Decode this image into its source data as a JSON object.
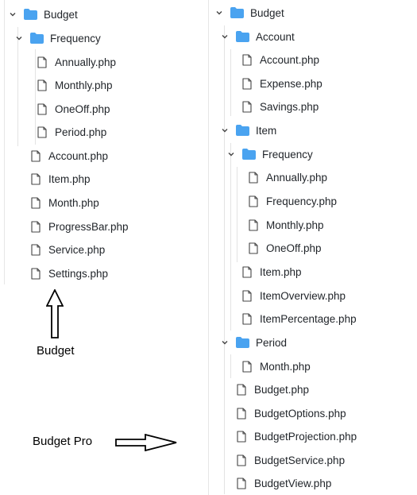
{
  "left_tree": {
    "root": "Budget",
    "frequency_folder": "Frequency",
    "frequency_files": [
      "Annually.php",
      "Monthly.php",
      "OneOff.php",
      "Period.php"
    ],
    "root_files": [
      "Account.php",
      "Item.php",
      "Month.php",
      "ProgressBar.php",
      "Service.php",
      "Settings.php"
    ]
  },
  "right_tree": {
    "root": "Budget",
    "account_folder": "Account",
    "account_files": [
      "Account.php",
      "Expense.php",
      "Savings.php"
    ],
    "item_folder": "Item",
    "item_frequency_folder": "Frequency",
    "item_frequency_files": [
      "Annually.php",
      "Frequency.php",
      "Monthly.php",
      "OneOff.php"
    ],
    "item_files": [
      "Item.php",
      "ItemOverview.php",
      "ItemPercentage.php"
    ],
    "period_folder": "Period",
    "period_files": [
      "Month.php"
    ],
    "root_files": [
      "Budget.php",
      "BudgetOptions.php",
      "BudgetProjection.php",
      "BudgetService.php",
      "BudgetView.php"
    ]
  },
  "captions": {
    "budget": "Budget",
    "budget_pro": "Budget Pro"
  },
  "icons": {
    "expand": "chevron-down-icon",
    "folder": "folder-icon",
    "file": "file-icon",
    "arrow_up": "arrow-up-icon",
    "arrow_right": "arrow-right-icon"
  },
  "colors": {
    "folder": "#4aa3f0",
    "text": "#1f2328",
    "guide": "#e3e3e3"
  }
}
